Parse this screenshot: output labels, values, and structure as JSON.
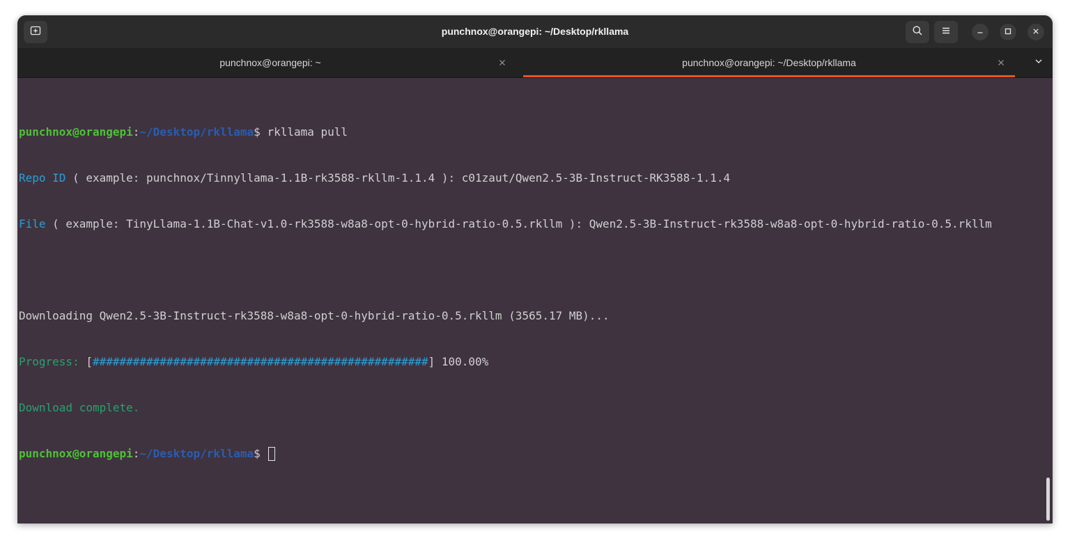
{
  "window": {
    "title": "punchnox@orangepi: ~/Desktop/rkllama"
  },
  "titlebar": {
    "icons": {
      "new_tab": "new-tab-icon",
      "search": "search-icon",
      "menu": "hamburger-menu-icon",
      "minimize": "minimize-icon",
      "maximize": "maximize-icon",
      "close": "close-icon"
    }
  },
  "tabs": [
    {
      "label": "punchnox@orangepi: ~",
      "active": false
    },
    {
      "label": "punchnox@orangepi: ~/Desktop/rkllama",
      "active": true
    }
  ],
  "colors": {
    "accent": "#e95420",
    "terminal_bg": "#3f3340",
    "prompt_user": "#4ec136",
    "prompt_path": "#2a5db0",
    "cyan_label": "#2a9fd6",
    "green_label": "#2aa16b"
  },
  "terminal": {
    "prompt_user": "punchnox@orangepi",
    "prompt_colon": ":",
    "prompt_path": "~/Desktop/rkllama",
    "prompt_symbol": "$ ",
    "command": "rkllama pull",
    "repo_label": "Repo ID",
    "repo_text": " ( example: punchnox/Tinnyllama-1.1B-rk3588-rkllm-1.1.4 ): c01zaut/Qwen2.5-3B-Instruct-RK3588-1.1.4",
    "file_label": "File",
    "file_text": " ( example: TinyLlama-1.1B-Chat-v1.0-rk3588-w8a8-opt-0-hybrid-ratio-0.5.rkllm ): Qwen2.5-3B-Instruct-rk3588-w8a8-opt-0-hybrid-ratio-0.5.rkllm",
    "downloading": "Downloading Qwen2.5-3B-Instruct-rk3588-w8a8-opt-0-hybrid-ratio-0.5.rkllm (3565.17 MB)...",
    "progress_label": "Progress: ",
    "progress_open": "[",
    "progress_bar": "##################################################",
    "progress_close": "] 100.00%",
    "complete": "Download complete."
  }
}
